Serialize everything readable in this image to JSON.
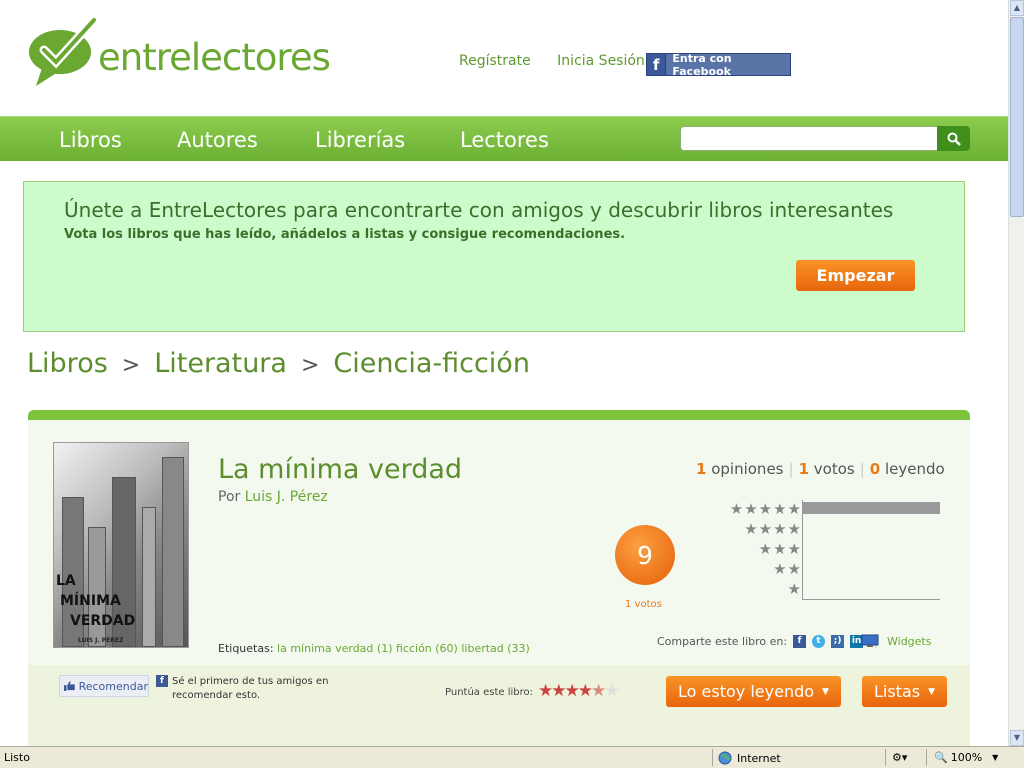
{
  "header": {
    "logo_text": "entrelectores",
    "register_link": "Regístrate",
    "login_link": "Inicia Sesión",
    "facebook_button": "Entra con Facebook"
  },
  "nav": {
    "items": [
      "Libros",
      "Autores",
      "Librerías",
      "Lectores"
    ],
    "search_placeholder": ""
  },
  "promo": {
    "title": "Únete a EntreLectores para encontrarte con amigos y descubrir libros interesantes",
    "subtitle": "Vota los libros que has leído, añádelos a listas y consigue recomendaciones.",
    "button": "Empezar"
  },
  "breadcrumb": {
    "items": [
      "Libros",
      "Literatura",
      "Ciencia-ficción"
    ],
    "separator": ">"
  },
  "book": {
    "cover_title_lines": [
      "LA",
      "MÍNIMA",
      "VERDAD"
    ],
    "cover_author": "LUIS J. PÉREZ",
    "title": "La mínima verdad",
    "by_label": "Por",
    "author": "Luis J. Pérez",
    "tags_label": "Etiquetas:",
    "tags": [
      "la mínima verdad (1)",
      "ficción (60)",
      "libertad (33)"
    ],
    "stats": {
      "opinions_count": "1",
      "opinions_label": "opiniones",
      "votes_count": "1",
      "votes_label": "votos",
      "reading_count": "0",
      "reading_label": "leyendo"
    },
    "score": "9",
    "score_votes": "1 votos",
    "rating_distribution": [
      {
        "stars": "★★★★★",
        "share": 1.0
      },
      {
        "stars": "★★★★",
        "share": 0
      },
      {
        "stars": "★★★",
        "share": 0
      },
      {
        "stars": "★★",
        "share": 0
      },
      {
        "stars": "★",
        "share": 0
      }
    ],
    "share_label": "Comparte este libro en:",
    "widgets_label": "Widgets"
  },
  "actions": {
    "recommend_button": "Recomendar",
    "recommend_text": "Sé el primero de tus amigos en recomendar esto.",
    "rate_label": "Puntúa este libro:",
    "rate_stars_filled": "★★★★",
    "rate_star_half": "★",
    "rate_star_empty": "★",
    "reading_button": "Lo estoy leyendo",
    "lists_button": "Listas",
    "dropdown_arrow": "▼"
  },
  "statusbar": {
    "status": "Listo",
    "zone": "Internet",
    "zoom": "100%"
  },
  "colors": {
    "brand_green": "#6aa832",
    "nav_green": "#7cc43c",
    "orange": "#e8650c",
    "promo_bg": "#ccfccc"
  }
}
